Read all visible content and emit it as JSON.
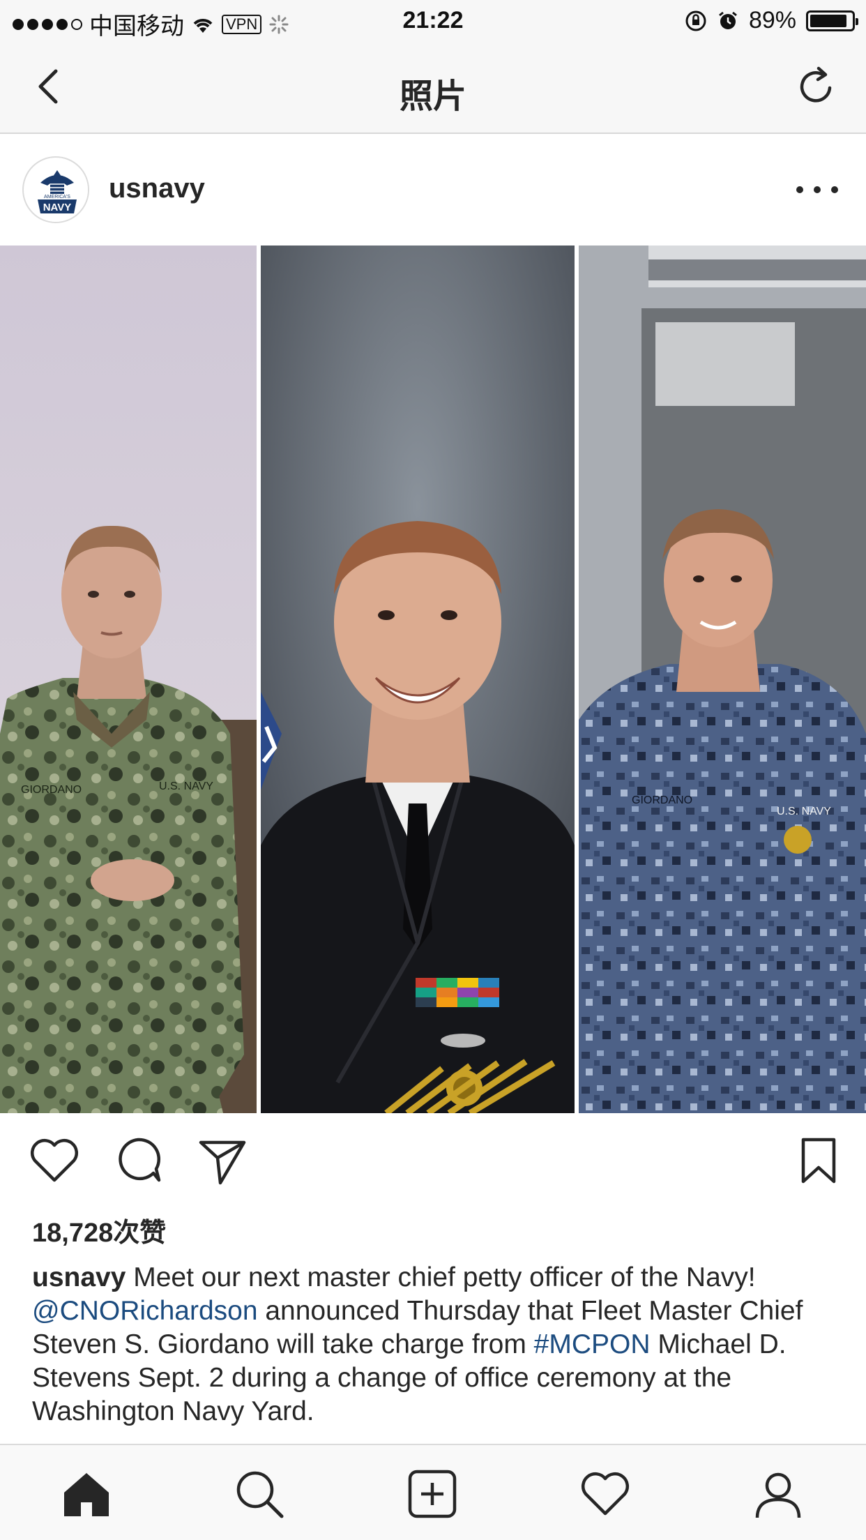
{
  "status_bar": {
    "carrier": "中国移动",
    "vpn": "VPN",
    "time": "21:22",
    "battery_level": 89,
    "battery_text": "89%"
  },
  "nav": {
    "title": "照片",
    "back_icon": "chevron-left-icon",
    "refresh_icon": "refresh-icon"
  },
  "post": {
    "username": "usnavy",
    "avatar_text": "AMERICA'S NAVY",
    "likes": "18,728次赞",
    "caption": {
      "user": "usnavy",
      "line1": " Meet our next master chief petty officer of the Navy!",
      "mention": "@CNORichardson",
      "text2": " announced Thursday that Fleet Master Chief Steven S. Giordano will take charge from ",
      "hashtag": "#MCPON",
      "text3": " Michael D. Stevens Sept. 2 during a change of office ceremony at the Washington Navy Yard."
    },
    "uniform_tags": {
      "left_name": "GIORDANO",
      "left_branch": "U.S. NAVY",
      "right_name": "GIORDANO",
      "right_branch": "U.S. NAVY"
    }
  },
  "tabs": [
    {
      "name": "home",
      "icon": "home-icon"
    },
    {
      "name": "search",
      "icon": "search-icon"
    },
    {
      "name": "add",
      "icon": "add-post-icon"
    },
    {
      "name": "activity",
      "icon": "heart-icon"
    },
    {
      "name": "profile",
      "icon": "profile-icon"
    }
  ],
  "colors": {
    "link": "#1b4b7f",
    "text": "#262626",
    "bar_bg": "#f7f7f7"
  }
}
